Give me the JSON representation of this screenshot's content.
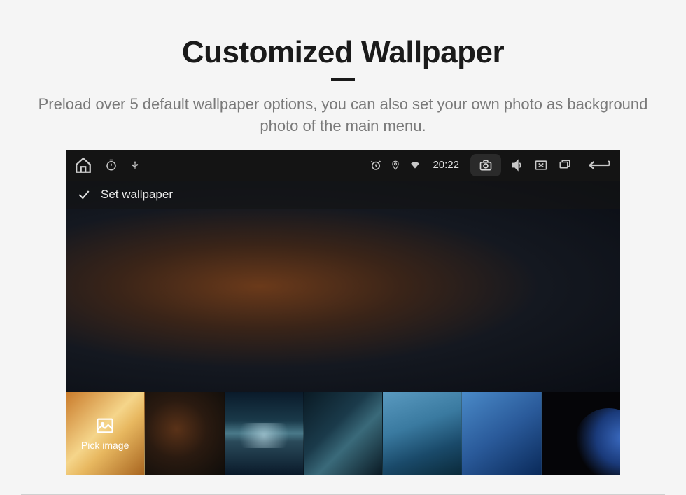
{
  "header": {
    "title": "Customized Wallpaper",
    "subtitle": "Preload over 5 default wallpaper options, you can also set your own photo as background photo of the main menu."
  },
  "statusbar": {
    "time": "20:22"
  },
  "titlebar": {
    "label": "Set wallpaper"
  },
  "thumbs": {
    "pick_label": "Pick image"
  }
}
